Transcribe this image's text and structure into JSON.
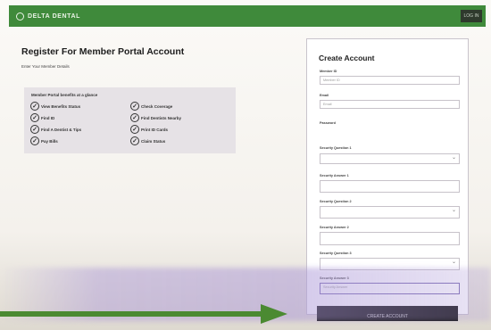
{
  "header": {
    "brand": "DELTA DENTAL",
    "login_label": "LOG IN"
  },
  "page": {
    "title": "Register For Member Portal Account",
    "subline": "Enter Your Member Details"
  },
  "benefits": {
    "heading": "Member Portal benefits at a glance",
    "items": [
      "View Benefits Status",
      "Find ID",
      "Find A Dentist & Tips",
      "Pay Bills",
      "Check Coverage",
      "Find Dentists Nearby",
      "Print ID Cards",
      "Claim Status"
    ]
  },
  "form": {
    "title": "Create Account",
    "fields": [
      {
        "label": "Member ID",
        "value": "",
        "placeholder": "Member ID"
      },
      {
        "label": "Email",
        "value": "",
        "placeholder": "Email"
      },
      {
        "label": "Password",
        "value": "",
        "placeholder": ""
      },
      {
        "label": "Security Question 1",
        "value": "",
        "placeholder": ""
      },
      {
        "label": "Security Answer 1",
        "value": "",
        "placeholder": ""
      },
      {
        "label": "Security Question 2",
        "value": "",
        "placeholder": ""
      },
      {
        "label": "Security Answer 2",
        "value": "",
        "placeholder": ""
      },
      {
        "label": "Security Question 3",
        "value": "",
        "placeholder": ""
      },
      {
        "label": "Security Answer 3",
        "value": "",
        "placeholder": "Security Answer"
      }
    ],
    "submit_label": "CREATE ACCOUNT"
  },
  "colors": {
    "brand_green": "#3f8a3b",
    "arrow_green": "#4b8a32",
    "focus_purple": "#7d6eb3",
    "button_dark": "#161616"
  },
  "icons": {
    "logo": "tooth-circle-icon",
    "check": "check-circle-icon",
    "select": "chevron-down-icon",
    "pointer": "arrow-right-icon"
  }
}
